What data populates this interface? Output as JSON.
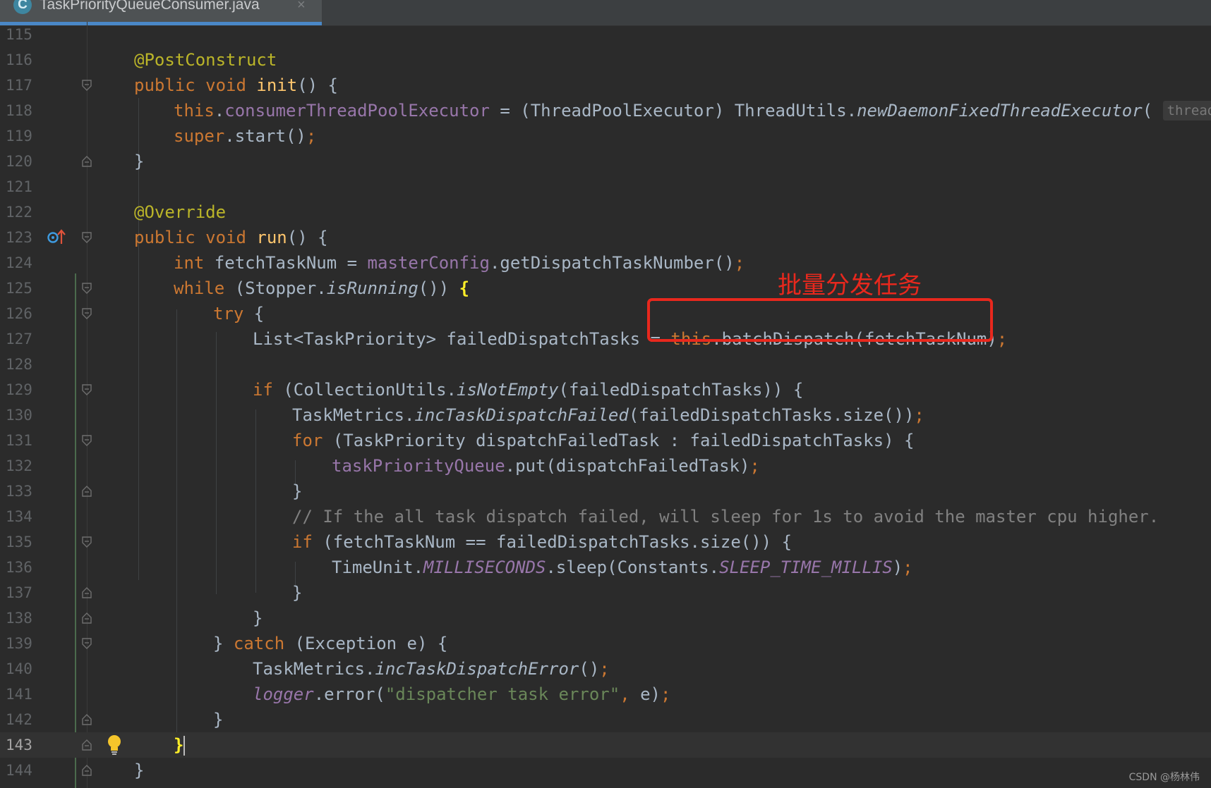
{
  "tab": {
    "icon_letter": "C",
    "title": "TaskPriorityQueueConsumer.java",
    "close_glyph": "×"
  },
  "annotation": {
    "text": "批量分发任务",
    "color": "#e8281d"
  },
  "watermark": "CSDN @杨林伟",
  "icons": {
    "tab_file": "java-class-icon",
    "override_marker": "override-arrow-icon",
    "intention": "lightbulb-icon",
    "fold": "fold-marker-icon"
  },
  "colors": {
    "background": "#2b2b2b",
    "keyword": "#cc7832",
    "annotation": "#bbb529",
    "field": "#9876aa",
    "method": "#ffc66d",
    "string": "#6a8759",
    "comment": "#808080",
    "default_text": "#a9b7c6",
    "tab_underline": "#4a88c7"
  },
  "current_line": "143",
  "lines": [
    {
      "n": "115",
      "t": {}
    },
    {
      "n": "116",
      "t": {
        "a": "@PostConstruct"
      }
    },
    {
      "n": "117",
      "t": {
        "a": "public",
        "b": " ",
        "c": "void",
        "d": " ",
        "e": "init",
        "f": "() {"
      }
    },
    {
      "n": "118",
      "t": {
        "a": "this",
        "b": ".",
        "c": "consumerThreadPoolExecutor",
        "d": " = (ThreadPoolExecutor) ThreadUtils.",
        "e": "newDaemonFixedThreadExecutor",
        "f": "(",
        "g": "threadNam"
      }
    },
    {
      "n": "119",
      "t": {
        "a": "super",
        "b": ".start()",
        "c": ";"
      }
    },
    {
      "n": "120",
      "t": {
        "a": "}"
      }
    },
    {
      "n": "121",
      "t": {}
    },
    {
      "n": "122",
      "t": {
        "a": "@Override"
      }
    },
    {
      "n": "123",
      "t": {
        "a": "public",
        "b": " ",
        "c": "void",
        "d": " ",
        "e": "run",
        "f": "() {"
      }
    },
    {
      "n": "124",
      "t": {
        "a": "int",
        "b": " fetchTaskNum = ",
        "c": "masterConfig",
        "d": ".getDispatchTaskNumber()",
        "e": ";"
      }
    },
    {
      "n": "125",
      "t": {
        "a": "while",
        "b": " (Stopper.",
        "c": "isRunning",
        "d": "()) ",
        "e": "{"
      }
    },
    {
      "n": "126",
      "t": {
        "a": "try",
        "b": " {"
      }
    },
    {
      "n": "127",
      "t": {
        "a": "List<TaskPriority> failedDispatchTasks = ",
        "b": "this",
        "c": ".batchDispatch(fetchTaskNum)",
        "d": ";"
      }
    },
    {
      "n": "128",
      "t": {}
    },
    {
      "n": "129",
      "t": {
        "a": "if",
        "b": " (CollectionUtils.",
        "c": "isNotEmpty",
        "d": "(failedDispatchTasks)) {"
      }
    },
    {
      "n": "130",
      "t": {
        "a": "TaskMetrics.",
        "b": "incTaskDispatchFailed",
        "c": "(failedDispatchTasks.size())",
        "d": ";"
      }
    },
    {
      "n": "131",
      "t": {
        "a": "for",
        "b": " (TaskPriority dispatchFailedTask : failedDispatchTasks) {"
      }
    },
    {
      "n": "132",
      "t": {
        "a": "taskPriorityQueue",
        "b": ".put(dispatchFailedTask)",
        "c": ";"
      }
    },
    {
      "n": "133",
      "t": {
        "a": "}"
      }
    },
    {
      "n": "134",
      "t": {
        "a": "// If the all task dispatch failed, will sleep for 1s to avoid the master cpu higher."
      }
    },
    {
      "n": "135",
      "t": {
        "a": "if",
        "b": " (fetchTaskNum == failedDispatchTasks.size()) {"
      }
    },
    {
      "n": "136",
      "t": {
        "a": "TimeUnit.",
        "b": "MILLISECONDS",
        "c": ".sleep(Constants.",
        "d": "SLEEP_TIME_MILLIS",
        "e": ")",
        "f": ";"
      }
    },
    {
      "n": "137",
      "t": {
        "a": "}"
      }
    },
    {
      "n": "138",
      "t": {
        "a": "}"
      }
    },
    {
      "n": "139",
      "t": {
        "a": "} ",
        "b": "catch",
        "c": " (Exception e) {"
      }
    },
    {
      "n": "140",
      "t": {
        "a": "TaskMetrics.",
        "b": "incTaskDispatchError",
        "c": "()",
        "d": ";"
      }
    },
    {
      "n": "141",
      "t": {
        "a": "logger",
        "b": ".error(",
        "c": "\"dispatcher task error\"",
        "d": ", ",
        "e": "e)",
        "f": ";"
      }
    },
    {
      "n": "142",
      "t": {
        "a": "}"
      }
    },
    {
      "n": "143",
      "t": {
        "a": "}"
      }
    },
    {
      "n": "144",
      "t": {
        "a": "}"
      }
    }
  ]
}
